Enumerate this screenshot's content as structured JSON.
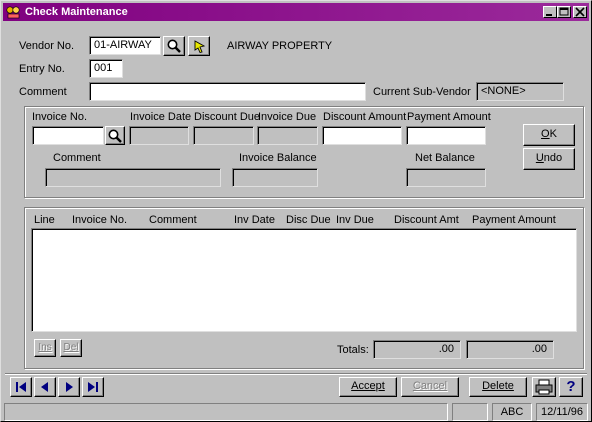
{
  "window": {
    "title": "Check Maintenance"
  },
  "header": {
    "vendor_label": "Vendor No.",
    "vendor_value": "01-AIRWAY",
    "vendor_name": "AIRWAY PROPERTY",
    "entry_label": "Entry No.",
    "entry_value": "001",
    "comment_label": "Comment",
    "comment_value": "",
    "subvendor_label": "Current Sub-Vendor",
    "subvendor_value": "<NONE>"
  },
  "invoice": {
    "invoice_no_label": "Invoice No.",
    "invoice_date_label": "Invoice Date",
    "discount_due_label": "Discount Due",
    "invoice_due_label": "Invoice Due",
    "discount_amount_label": "Discount Amount",
    "payment_amount_label": "Payment Amount",
    "comment_label": "Comment",
    "invoice_balance_label": "Invoice Balance",
    "net_balance_label": "Net Balance",
    "ok_label": "OK",
    "ok_mnemonic": "O",
    "undo_label": "Undo",
    "undo_mnemonic": "U"
  },
  "grid": {
    "columns": [
      "Line",
      "Invoice No.",
      "Comment",
      "Inv Date",
      "Disc Due",
      "Inv Due",
      "Discount Amt",
      "Payment Amount"
    ],
    "ins_label": "Ins",
    "del_label": "Del",
    "totals_label": "Totals:",
    "total_discount": ".00",
    "total_payment": ".00"
  },
  "actions": {
    "accept_label": "Accept",
    "cancel_label": "Cancel",
    "delete_label": "Delete",
    "help_label": "?"
  },
  "status": {
    "message": "",
    "caps": "",
    "mode": "ABC",
    "date": "12/11/96"
  },
  "colors": {
    "titlebar": "#800080",
    "face": "#c0c0c0",
    "nav_arrow": "#000080"
  }
}
